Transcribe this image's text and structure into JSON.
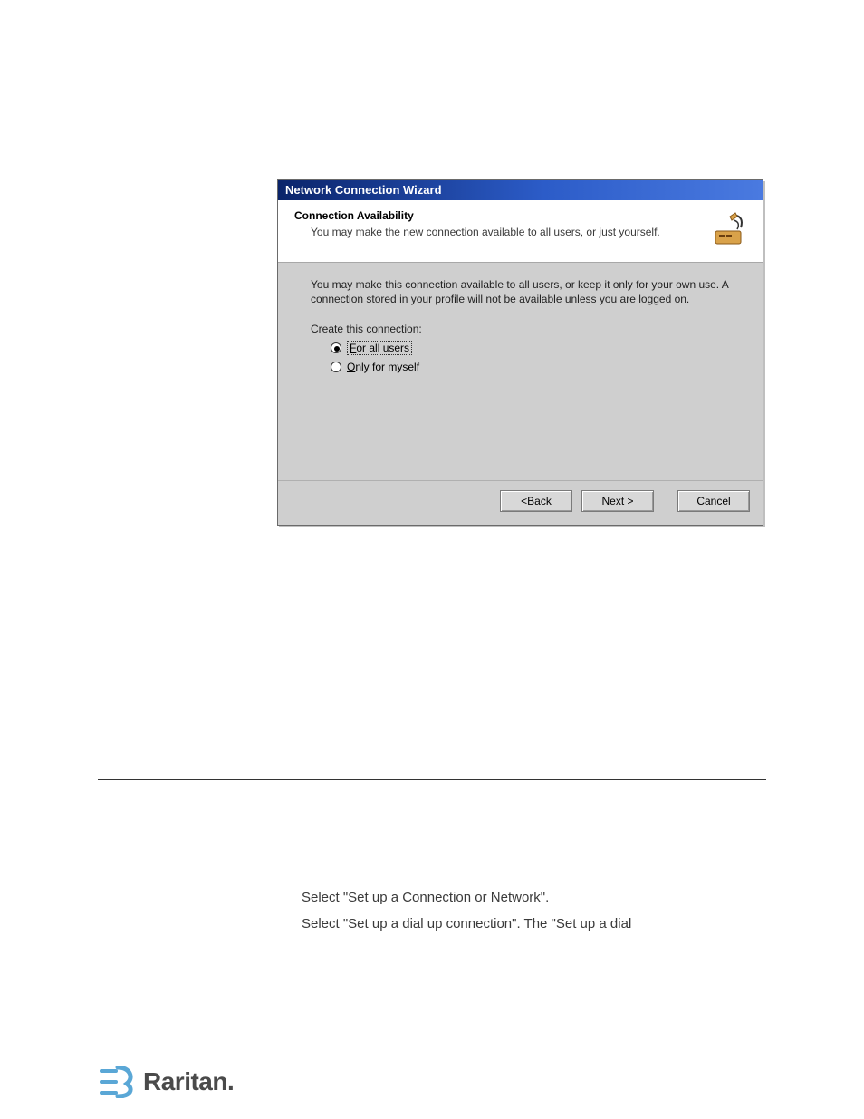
{
  "dialog": {
    "title": "Network Connection Wizard",
    "header": {
      "heading": "Connection Availability",
      "subtext": "You may make the new connection available to all users, or just yourself.",
      "icon": "network-modem-icon"
    },
    "body": {
      "info": "You may make this connection available to all users, or keep it only for your own use. A connection stored in your profile will not be available unless you are logged on.",
      "group_label": "Create this connection:",
      "options": [
        {
          "label_pre": "",
          "accel": "F",
          "label_post": "or all users",
          "checked": true
        },
        {
          "label_pre": "",
          "accel": "O",
          "label_post": "nly for myself",
          "checked": false
        }
      ]
    },
    "buttons": {
      "back": {
        "lt": "< ",
        "accel": "B",
        "post": "ack"
      },
      "next": {
        "accel": "N",
        "post": "ext >"
      },
      "cancel": "Cancel"
    }
  },
  "doc_lines": [
    "Select \"Set up a Connection or Network\".",
    "Select \"Set up a dial up connection\". The \"Set up a dial"
  ],
  "brand": {
    "name": "Raritan.",
    "accent": "#5aa7d6"
  }
}
